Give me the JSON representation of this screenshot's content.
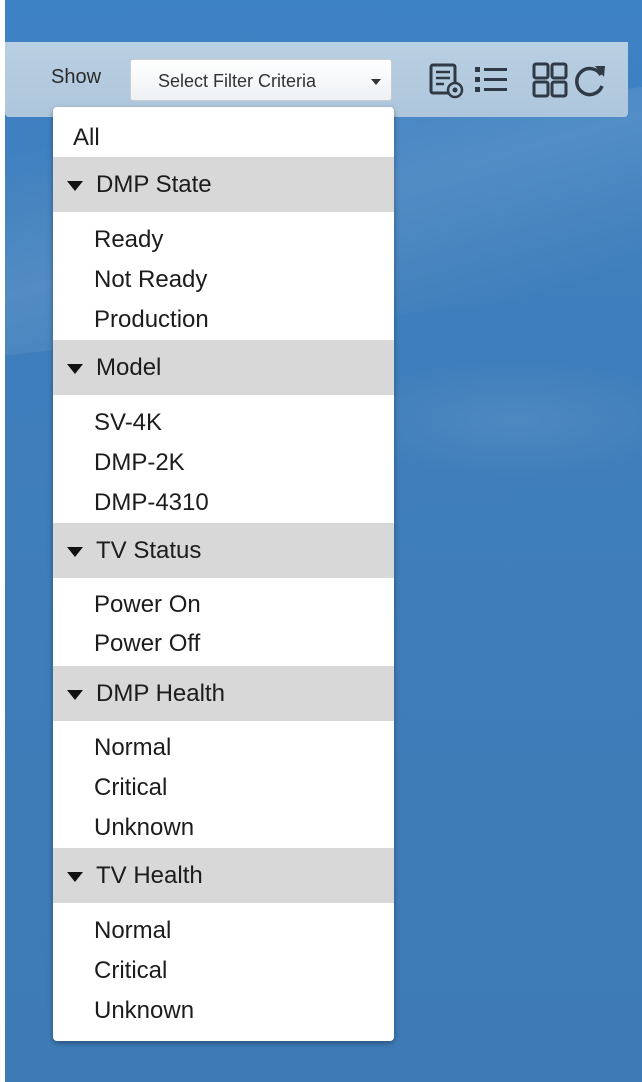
{
  "toolbar": {
    "show_label": "Show",
    "filter_select_label": "Select Filter Criteria",
    "icons": [
      "details-view-icon",
      "list-view-icon",
      "grid-view-icon",
      "refresh-icon"
    ]
  },
  "dropdown": {
    "all_label": "All",
    "groups": [
      {
        "label": "DMP State",
        "items": [
          "Ready",
          "Not Ready",
          "Production"
        ]
      },
      {
        "label": "Model",
        "items": [
          "SV-4K",
          "DMP-2K",
          "DMP-4310"
        ]
      },
      {
        "label": "TV Status",
        "items": [
          "Power On",
          "Power Off"
        ]
      },
      {
        "label": "DMP Health",
        "items": [
          "Normal",
          "Critical",
          "Unknown"
        ]
      },
      {
        "label": "TV Health",
        "items": [
          "Normal",
          "Critical",
          "Unknown"
        ]
      }
    ]
  },
  "colors": {
    "background": "#3e7bb6",
    "toolbar": "#b3cadf",
    "group_header": "#d8d8d8",
    "icon": "#2f3a46"
  }
}
